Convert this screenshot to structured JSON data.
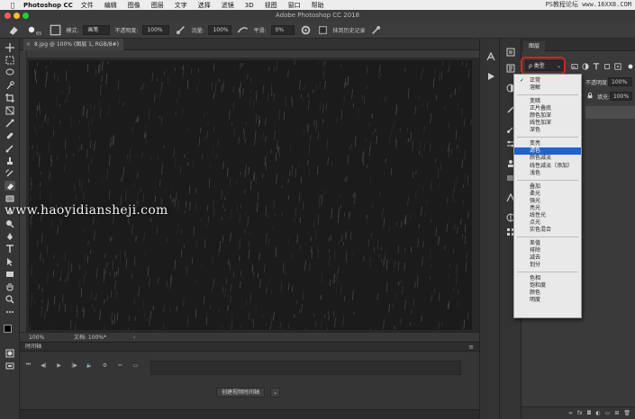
{
  "menubar": {
    "app_name": "Photoshop CC",
    "items": [
      "文件",
      "编辑",
      "图像",
      "图层",
      "文字",
      "选择",
      "滤镜",
      "3D",
      "视图",
      "窗口",
      "帮助"
    ],
    "watermark": "PS教程论坛 www.16XX8.COM"
  },
  "window": {
    "title": "Adobe Photoshop CC 2018",
    "traffic_colors": [
      "#ff5f57",
      "#febc2e",
      "#28c840"
    ]
  },
  "options_bar": {
    "brush_size": "65",
    "mode_label": "模式:",
    "mode_value": "画笔",
    "opacity_label": "不透明度:",
    "opacity_value": "100%",
    "flow_label": "流量:",
    "flow_value": "100%",
    "smoothing_label": "平滑:",
    "smoothing_value": "0%",
    "history_label": "抹到历史记录"
  },
  "document": {
    "tab_title": "8.jpg @ 100% (图层 1, RGB/8#)",
    "tab_close": "×",
    "zoom": "100%",
    "status_info": "文档: 100%*",
    "status_arrow": "›",
    "canvas_color": "#1b1b1b"
  },
  "watermark_mid": "www.haoyidiansheji.com",
  "timeline": {
    "title": "时间轴",
    "menu_glyph": "≡",
    "controls": [
      "⏮",
      "◀|",
      "▶",
      "|▶",
      "🔈",
      "⚙",
      "✂",
      "▭"
    ],
    "create_button": "创建视频时间轴",
    "create_dropdown": "⌄"
  },
  "layers_panel": {
    "tab_label": "图层",
    "kind_select": "ρ 类型",
    "kind_dropdown": "⌄",
    "opacity_label": "不透明度:",
    "opacity_value": "100%",
    "fill_label": "填充:",
    "fill_value": "100%",
    "highlight_color": "#d6241e",
    "footer_icons": [
      "∞",
      "fx",
      "◘",
      "◐",
      "▭",
      "⊞",
      "🗑"
    ]
  },
  "blend_menu": {
    "checked": "✓",
    "groups": [
      [
        "正常",
        "溶解"
      ],
      [
        "变暗",
        "正片叠底",
        "颜色加深",
        "线性加深",
        "深色"
      ],
      [
        "变亮",
        "滤色",
        "颜色减淡",
        "线性减淡（添加）",
        "浅色"
      ],
      [
        "叠加",
        "柔光",
        "强光",
        "亮光",
        "线性光",
        "点光",
        "实色混合"
      ],
      [
        "差值",
        "排除",
        "减去",
        "划分"
      ],
      [
        "色相",
        "饱和度",
        "颜色",
        "明度"
      ]
    ],
    "selected": "滤色",
    "selected_color": "#1f63d0"
  }
}
